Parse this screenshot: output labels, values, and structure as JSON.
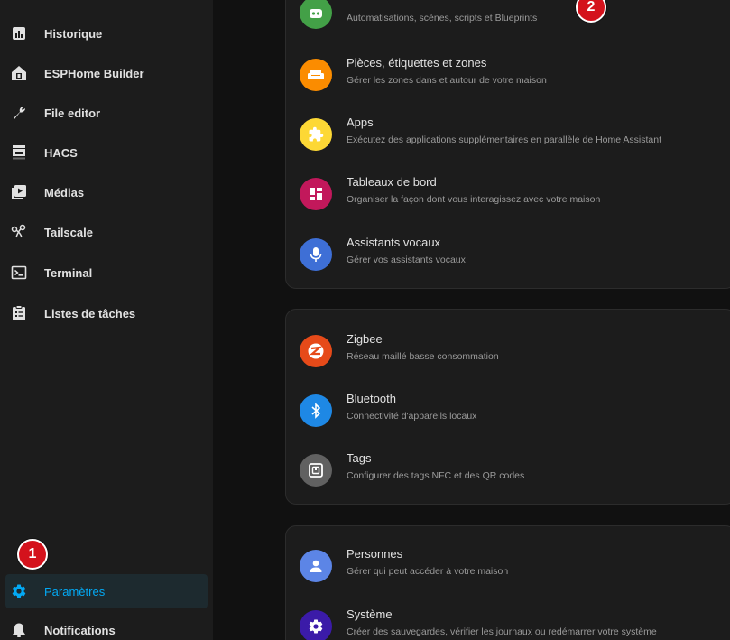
{
  "sidebar": {
    "items": [
      {
        "label": "Historique",
        "icon": "chart-box-icon"
      },
      {
        "label": "ESPHome Builder",
        "icon": "esphome-icon"
      },
      {
        "label": "File editor",
        "icon": "wrench-icon"
      },
      {
        "label": "HACS",
        "icon": "hacs-store-icon"
      },
      {
        "label": "Médias",
        "icon": "media-play-icon"
      },
      {
        "label": "Tailscale",
        "icon": "tailscale-icon"
      },
      {
        "label": "Terminal",
        "icon": "console-icon"
      },
      {
        "label": "Listes de tâches",
        "icon": "clipboard-list-icon"
      }
    ],
    "settings_label": "Paramètres",
    "notifications_label": "Notifications"
  },
  "sections": {
    "group1": [
      {
        "title": "",
        "subtitle": "Automatisations, scènes, scripts et Blueprints",
        "icon": "robot-icon",
        "color": "#43a047"
      },
      {
        "title": "Pièces, étiquettes et zones",
        "subtitle": "Gérer les zones dans et autour de votre maison",
        "icon": "sofa-icon",
        "color": "#fb8c00"
      },
      {
        "title": "Apps",
        "subtitle": "Exécutez des applications supplémentaires en parallèle de Home Assistant",
        "icon": "puzzle-icon",
        "color": "#fdd835"
      },
      {
        "title": "Tableaux de bord",
        "subtitle": "Organiser la façon dont vous interagissez avec votre maison",
        "icon": "dashboard-icon",
        "color": "#c2185b"
      },
      {
        "title": "Assistants vocaux",
        "subtitle": "Gérer vos assistants vocaux",
        "icon": "microphone-icon",
        "color": "#3e6fd6"
      }
    ],
    "group2": [
      {
        "title": "Zigbee",
        "subtitle": "Réseau maillé basse consommation",
        "icon": "zigbee-icon",
        "color": "#e64a19"
      },
      {
        "title": "Bluetooth",
        "subtitle": "Connectivité d'appareils locaux",
        "icon": "bluetooth-icon",
        "color": "#1e88e5"
      },
      {
        "title": "Tags",
        "subtitle": "Configurer des tags NFC et des QR codes",
        "icon": "nfc-tag-icon",
        "color": "#616161"
      }
    ],
    "group3": [
      {
        "title": "Personnes",
        "subtitle": "Gérer qui peut accéder à votre maison",
        "icon": "account-icon",
        "color": "#5c85e6"
      },
      {
        "title": "Système",
        "subtitle": "Créer des sauvegardes, vérifier les journaux ou redémarrer votre système",
        "icon": "cog-icon",
        "color": "#3b1ba8"
      }
    ]
  },
  "annotations": {
    "badge1": "1",
    "badge2": "2"
  },
  "colors": {
    "accent": "#03a9f4",
    "badge": "#d4121c",
    "sidebar_bg": "#1c1c1c",
    "page_bg": "#111111"
  }
}
